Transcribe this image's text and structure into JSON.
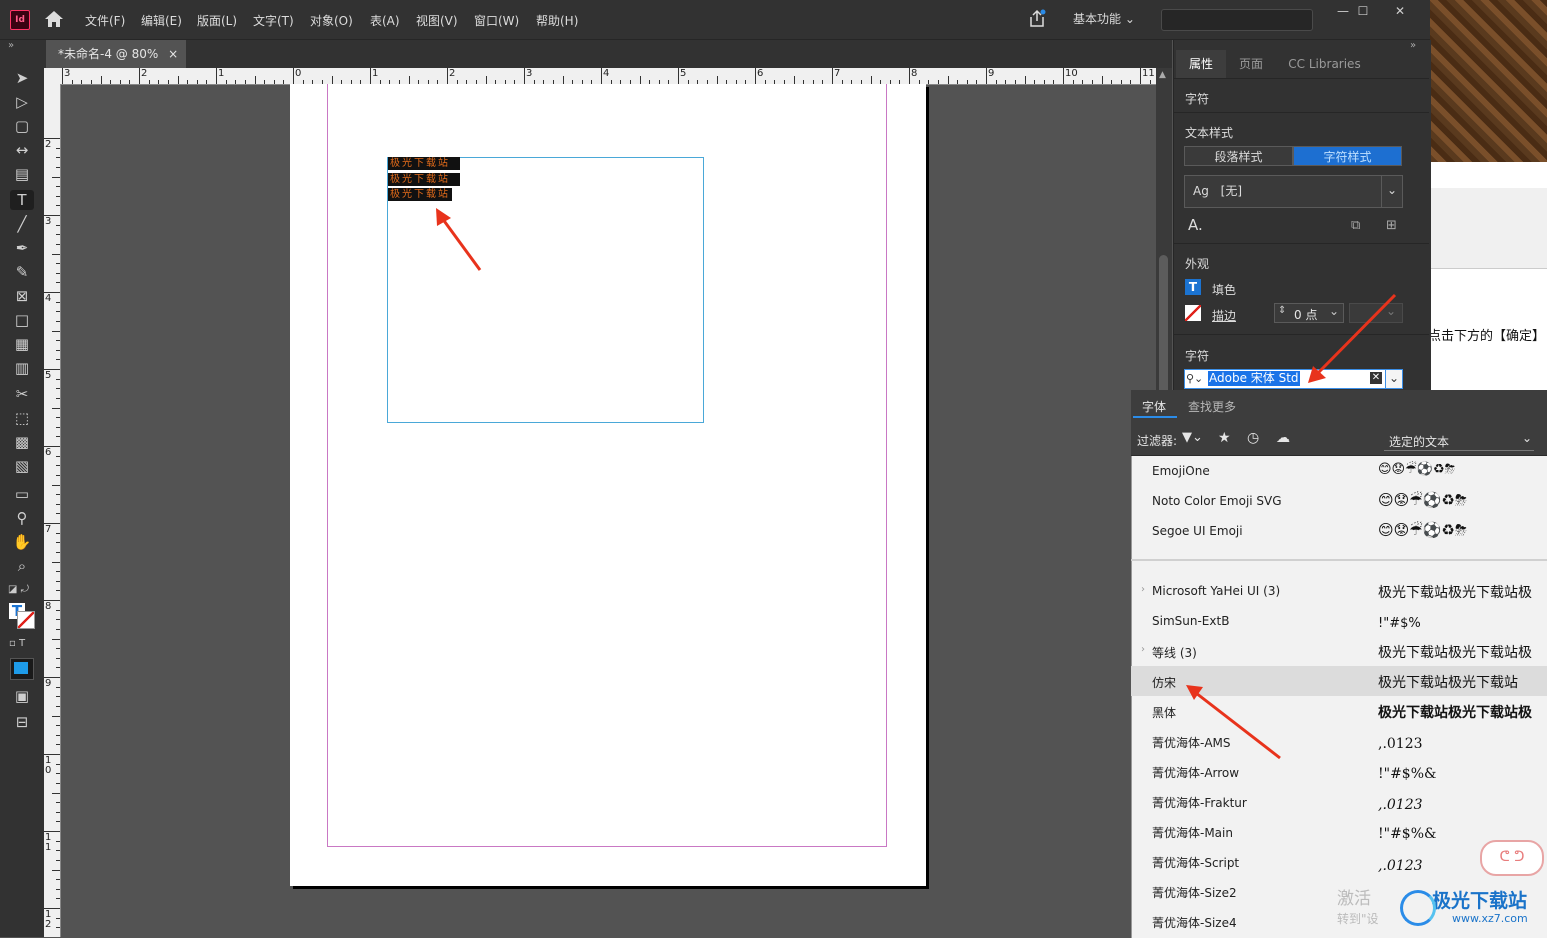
{
  "app": {
    "icon_label": "Id"
  },
  "menu": [
    "文件(F)",
    "编辑(E)",
    "版面(L)",
    "文字(T)",
    "对象(O)",
    "表(A)",
    "视图(V)",
    "窗口(W)",
    "帮助(H)"
  ],
  "workspace": "基本功能",
  "window_controls": {
    "minimize": "—",
    "maximize": "☐",
    "close": "✕"
  },
  "document_tab": {
    "title": "*未命名-4 @ 80%",
    "close": "×"
  },
  "ruler": {
    "h_labels": [
      "3",
      "2",
      "1",
      "0",
      "1",
      "2",
      "3",
      "4",
      "5",
      "6",
      "7",
      "8",
      "9",
      "10",
      "11"
    ],
    "v_labels": [
      "2",
      "3",
      "4",
      "5",
      "6",
      "7",
      "8",
      "9",
      "10",
      "11",
      "12"
    ]
  },
  "selected_text_lines": [
    "极光下载站",
    "极光下载站",
    "极光下载站"
  ],
  "panel": {
    "tabs": [
      "属性",
      "页面",
      "CC Libraries"
    ],
    "active_tab": "属性",
    "section_title": "字符",
    "text_style": {
      "label": "文本样式",
      "segments": [
        "段落样式",
        "字符样式"
      ],
      "active_segment": "字符样式",
      "dropdown_prefix": "Ag",
      "dropdown_value": "[无]"
    },
    "appearance": {
      "label": "外观",
      "fill_label": "填色",
      "stroke_label": "描边",
      "stroke_value": "0 点"
    },
    "character": {
      "label": "字符",
      "font_value": "Adobe 宋体 Std"
    }
  },
  "font_list": {
    "tabs": [
      "字体",
      "查找更多"
    ],
    "active_tab": "字体",
    "filter_label": "过滤器:",
    "filter_dropdown": "选定的文本",
    "fonts": [
      {
        "name": "EmojiOne",
        "sample": "😊😟☔⚽♻⛈"
      },
      {
        "name": "Noto Color Emoji SVG",
        "sample": "😊😟☔⚽♻⛈"
      },
      {
        "name": "Segoe UI Emoji",
        "sample": "😊😟☔⚽♻⛈"
      },
      {
        "name": "Microsoft YaHei UI (3)",
        "sample": "极光下载站极光下载站极"
      },
      {
        "name": "SimSun-ExtB",
        "sample": "!\"#$%"
      },
      {
        "name": "等线 (3)",
        "sample": "极光下载站极光下载站极"
      },
      {
        "name": "仿宋",
        "sample": "极光下载站极光下载站"
      },
      {
        "name": "黑体",
        "sample": "极光下载站极光下载站极"
      },
      {
        "name": "菁优海体-AMS",
        "sample": ",.0123"
      },
      {
        "name": "菁优海体-Arrow",
        "sample": "!\"#$%&"
      },
      {
        "name": "菁优海体-Fraktur",
        "sample": ",.0123"
      },
      {
        "name": "菁优海体-Main",
        "sample": "!\"#$%&"
      },
      {
        "name": "菁优海体-Script",
        "sample": ",.0123"
      },
      {
        "name": "菁优海体-Size2",
        "sample": ""
      },
      {
        "name": "菁优海体-Size4",
        "sample": ""
      }
    ]
  },
  "background_window": {
    "text": "点击下方的【确定】"
  },
  "watermark": {
    "line1": "激活",
    "line2": "转到\"设",
    "brand": "极光下载站",
    "url": "www.xz7.com"
  }
}
